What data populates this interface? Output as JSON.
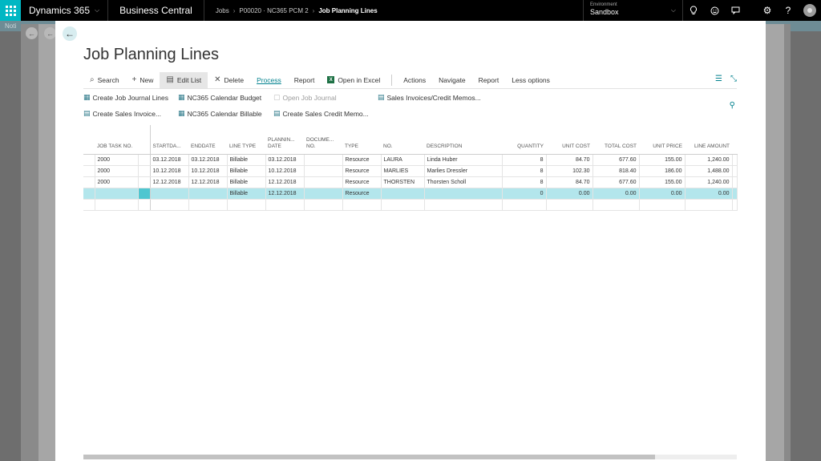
{
  "topbar": {
    "brand": "Dynamics 365",
    "product": "Business Central",
    "breadcrumb": [
      "Jobs",
      "P00020 · NC365 PCM 2",
      "Job Planning Lines"
    ],
    "environment_label": "Environment",
    "environment_value": "Sandbox",
    "icons": [
      "lightbulb-icon",
      "smiley-icon",
      "chat-icon",
      "gear-icon",
      "help-icon",
      "user-icon"
    ]
  },
  "backdrop": {
    "notification_text": "Noti"
  },
  "dialog": {
    "title": "Job Planning Lines",
    "actions": [
      {
        "label": "Search",
        "icon": "search-icon"
      },
      {
        "label": "New",
        "icon": "plus-icon"
      },
      {
        "label": "Edit List",
        "icon": "edit-list-icon"
      },
      {
        "label": "Delete",
        "icon": "delete-icon"
      },
      {
        "label": "Process"
      },
      {
        "label": "Report"
      },
      {
        "label": "Open in Excel",
        "icon": "excel-icon"
      },
      {
        "label": "Actions"
      },
      {
        "label": "Navigate"
      },
      {
        "label": "Report"
      },
      {
        "label": "Less options"
      }
    ],
    "sub_actions": {
      "create_job_journal_lines": "Create Job Journal Lines",
      "nc365_calendar_budget": "NC365 Calendar Budget",
      "open_job_journal": "Open Job Journal",
      "sales_invoices_credit_memos": "Sales Invoices/Credit Memos...",
      "create_sales_invoice": "Create Sales Invoice...",
      "nc365_calendar_billable": "NC365 Calendar Billable",
      "create_sales_credit_memo": "Create Sales Credit Memo..."
    },
    "columns": {
      "job_task_no": "JOB TASK NO.",
      "start_date": "STARTDA...",
      "end_date": "ENDDATE",
      "line_type": "LINE TYPE",
      "planning_date": "PLANNIN... DATE",
      "document_no": "DOCUME... NO.",
      "type": "TYPE",
      "no": "NO.",
      "description": "DESCRIPTION",
      "quantity": "QUANTITY",
      "unit_cost": "UNIT COST",
      "total_cost": "TOTAL COST",
      "unit_price": "UNIT PRICE",
      "line_amount": "LINE AMOUNT"
    },
    "rows": [
      {
        "job_task_no": "2000",
        "start_date": "03.12.2018",
        "end_date": "03.12.2018",
        "line_type": "Billable",
        "planning_date": "03.12.2018",
        "document_no": "",
        "type": "Resource",
        "no": "LAURA",
        "description": "Linda Huber",
        "quantity": "8",
        "unit_cost": "84.70",
        "total_cost": "677.60",
        "unit_price": "155.00",
        "line_amount": "1,240.00"
      },
      {
        "job_task_no": "2000",
        "start_date": "10.12.2018",
        "end_date": "10.12.2018",
        "line_type": "Billable",
        "planning_date": "10.12.2018",
        "document_no": "",
        "type": "Resource",
        "no": "MARLIES",
        "description": "Marlies Dressler",
        "quantity": "8",
        "unit_cost": "102.30",
        "total_cost": "818.40",
        "unit_price": "186.00",
        "line_amount": "1,488.00"
      },
      {
        "job_task_no": "2000",
        "start_date": "12.12.2018",
        "end_date": "12.12.2018",
        "line_type": "Billable",
        "planning_date": "12.12.2018",
        "document_no": "",
        "type": "Resource",
        "no": "THORSTEN",
        "description": "Thorsten Scholl",
        "quantity": "8",
        "unit_cost": "84.70",
        "total_cost": "677.60",
        "unit_price": "155.00",
        "line_amount": "1,240.00"
      },
      {
        "job_task_no": "",
        "start_date": "",
        "end_date": "",
        "line_type": "Billable",
        "planning_date": "12.12.2018",
        "document_no": "",
        "type": "Resource",
        "no": "",
        "description": "",
        "quantity": "0",
        "unit_cost": "0.00",
        "total_cost": "0.00",
        "unit_price": "0.00",
        "line_amount": "0.00"
      }
    ],
    "colors": {
      "accent": "#00b7c3",
      "link": "#00808d",
      "active_row": "#b3e6ec",
      "selected_cell": "#4fc6d0"
    }
  }
}
